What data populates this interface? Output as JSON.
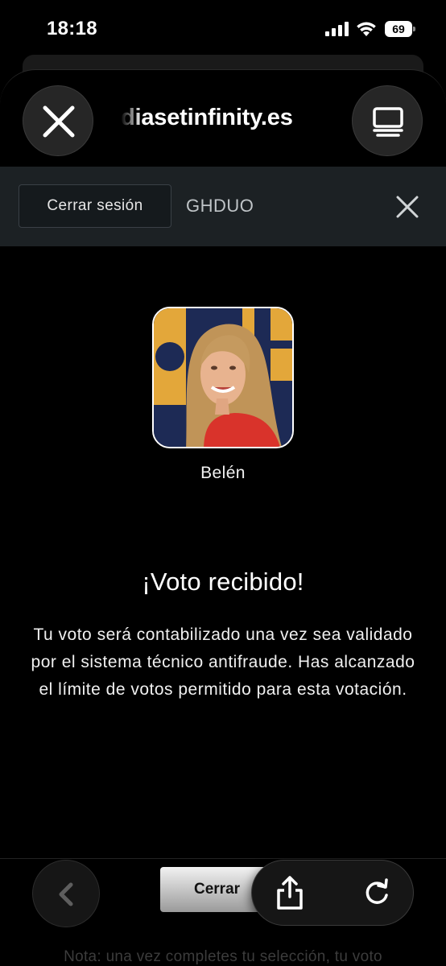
{
  "status_bar": {
    "time": "18:18",
    "battery": "69"
  },
  "browser": {
    "url": "diasetinfinity.es"
  },
  "session": {
    "logout_label": "Cerrar sesión",
    "user_code": "GHDUO"
  },
  "candidate": {
    "name": "Belén"
  },
  "result": {
    "title": "¡Voto recibido!",
    "message": "Tu voto será contabilizado una vez sea validado por el sistema técnico antifraude. Has alcanzado el límite de votos permitido para esta votación."
  },
  "footer": {
    "close_label": "Cerrar",
    "note": "Nota: una vez completes tu selección, tu voto"
  },
  "colors": {
    "session_bar": "#1c2124",
    "avatar_bg_navy": "#1d2a55",
    "avatar_bg_gold": "#e3a73a",
    "candidate_top": "#d9332b"
  }
}
